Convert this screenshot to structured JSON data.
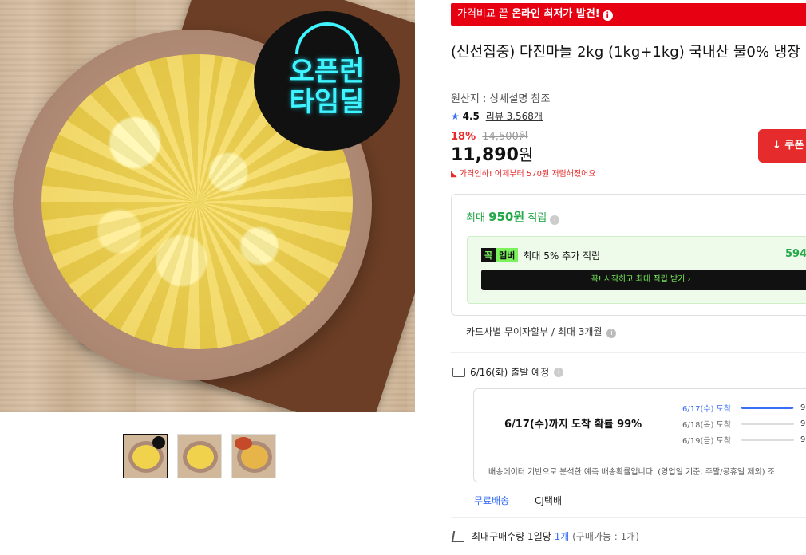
{
  "hero": {
    "badge_line1": "오픈런",
    "badge_line2": "타임딜"
  },
  "promo": {
    "text_prefix": "가격비교 끝 ",
    "text_strong": "온라인 최저가 발견!",
    "info_glyph": "i"
  },
  "product": {
    "title": "(신선집중) 다진마늘 2kg (1kg+1kg) 국내산 물0% 냉장",
    "origin": "원산지 : 상세설명 참조",
    "rating_score": "4.5",
    "review_text": "리뷰 3,568개",
    "discount": "18%",
    "original_price": "14,500원",
    "price_value": "11,890",
    "price_unit": "원",
    "price_drop": "가격인하! 어제부터 570원 저렴해졌어요",
    "coupon_label": "쿠폰"
  },
  "points": {
    "prefix": "최대 ",
    "amount": "950원",
    "suffix": " 적립",
    "member_k": "꼭",
    "member_m": "멤버",
    "member_text": "최대 5% 추가 적립",
    "member_value": "594",
    "member_button": "꼭! 시작하고 최대 적립 받기 ›"
  },
  "installment": {
    "text": "카드사별 무이자할부 / 최대 3개월"
  },
  "shipping": {
    "depart": "6/16(화) 출발 예정",
    "probability": "6/17(수)까지 도착 확률 99%",
    "rows": [
      {
        "label": "6/17(수) 도착",
        "pct": 99,
        "pct_text": "9"
      },
      {
        "label": "6/18(목) 도착",
        "pct": 0,
        "pct_text": "9"
      },
      {
        "label": "6/19(금) 도착",
        "pct": 0,
        "pct_text": "9"
      }
    ],
    "note": "배송데이터 기반으로 분석한 예측 배송확률입니다. (영업일 기준, 주말/공휴일 제외) 조",
    "free": "무료배송",
    "courier": "CJ택배"
  },
  "purchase": {
    "label": "최대구매수량 1일당 ",
    "qty": "1개",
    "note": " (구매가능 : 1개)"
  },
  "colors": {
    "accent_red": "#e60012",
    "blue": "#3b6ff5",
    "green": "#24a84a"
  }
}
